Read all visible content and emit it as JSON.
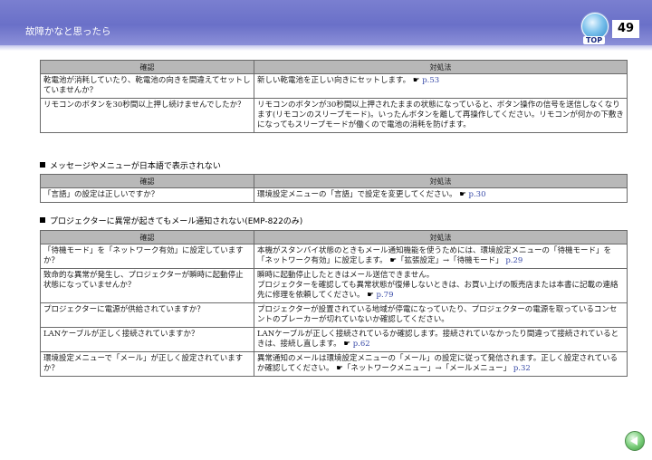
{
  "header": {
    "title": "故障かなと思ったら",
    "page_number": "49",
    "top_label": "TOP"
  },
  "table1": {
    "col_check": "確認",
    "col_action": "対処法",
    "rows": [
      {
        "check": "乾電池が消耗していたり、乾電池の向きを間違えてセットしていませんか？",
        "action": "新しい乾電池を正しい向きにセットします。",
        "ref": "p.53"
      },
      {
        "check": "リモコンのボタンを30秒間以上押し続けませんでしたか？",
        "action": "リモコンのボタンが30秒間以上押されたままの状態になっていると、ボタン操作の信号を送信しなくなります(リモコンのスリープモード)。いったんボタンを離して再操作してください。リモコンが何かの下敷きになってもスリープモードが働くので電池の消耗を防げます。",
        "ref": ""
      }
    ]
  },
  "section2": {
    "heading": "メッセージやメニューが日本語で表示されない"
  },
  "table2": {
    "col_check": "確認",
    "col_action": "対処法",
    "rows": [
      {
        "check": "「言語」の設定は正しいですか？",
        "action": "環境設定メニューの「言語」で設定を変更してください。",
        "ref": "p.30"
      }
    ]
  },
  "section3": {
    "heading": "プロジェクターに異常が起きてもメール通知されない(EMP-822のみ)"
  },
  "table3": {
    "col_check": "確認",
    "col_action": "対処法",
    "rows": [
      {
        "check": "「待機モード」を「ネットワーク有効」に設定していますか？",
        "action": "本機がスタンバイ状態のときもメール通知機能を使うためには、環境設定メニューの「待機モード」を「ネットワーク有効」に設定します。",
        "action_tail": "「拡張設定」→「待機モード」",
        "ref": "p.29"
      },
      {
        "check": "致命的な異常が発生し、プロジェクターが瞬時に起動停止状態になっていませんか？",
        "action": "瞬時に起動停止したときはメール送信できません。",
        "action2": "プロジェクターを確認しても異常状態が復帰しないときは、お買い上げの販売店または本書に記載の連絡先に修理を依頼してください。",
        "ref": "p.79"
      },
      {
        "check": "プロジェクターに電源が供給されていますか？",
        "action": "プロジェクターが設置されている地域が停電になっていたり、プロジェクターの電源を取っているコンセントのブレーカーが切れていないか確認してください。",
        "ref": ""
      },
      {
        "check": "LANケーブルが正しく接続されていますか？",
        "action": "LANケーブルが正しく接続されているか確認します。接続されていなかったり間違って接続されているときは、接続し直します。",
        "ref": "p.62"
      },
      {
        "check": "環境設定メニューで「メール」が正しく設定されていますか？",
        "action": "異常通知のメールは環境設定メニューの「メール」の設定に従って発信されます。正しく設定されているか確認してください。",
        "action_tail": "「ネットワークメニュー」→「メールメニュー」",
        "ref": "p.32"
      }
    ]
  },
  "icons": {
    "reference": "pointing-hand-icon",
    "top": "top-globe-icon",
    "back": "back-arrow-icon"
  },
  "colors": {
    "header": "#7a7fd0",
    "table_header": "#b8b8b8",
    "ref_link": "#3a4ca8"
  }
}
